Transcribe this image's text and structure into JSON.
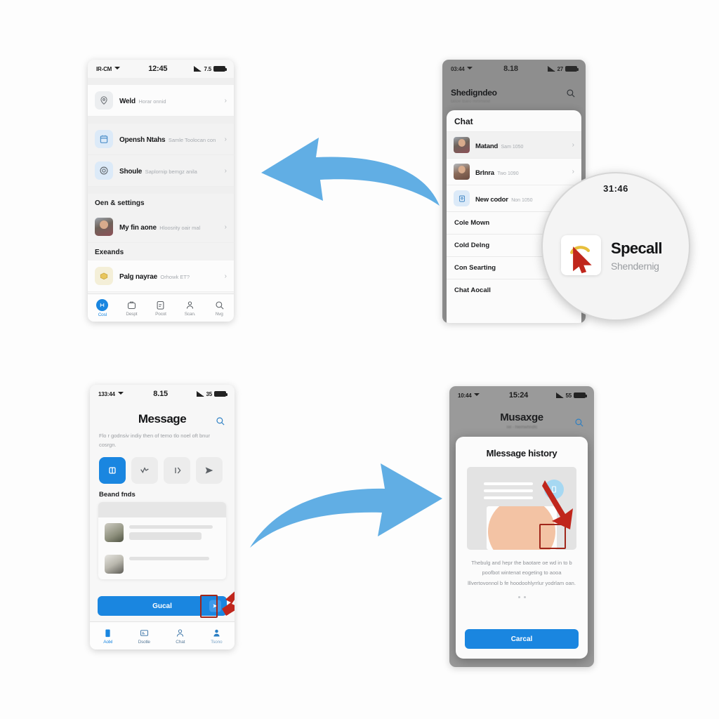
{
  "panel1": {
    "name": "settings-screen",
    "status": {
      "carrier": "IR-CM",
      "time": "12:45",
      "network": "7.5"
    },
    "rows": [
      {
        "title": "Weld",
        "subtitle": "Horar onnid",
        "icon": "location-pin-icon"
      },
      {
        "title": "Opensh Ntahs",
        "subtitle": "Samle Toolocan con",
        "icon": "calendar-icon"
      },
      {
        "title": "Shoule",
        "subtitle": "Saplornip bemgz anila",
        "icon": "target-icon"
      }
    ],
    "section_account": "Oen & settings",
    "account_row": {
      "title": "My fin aone",
      "subtitle": "Hloosrity oair mal"
    },
    "section_extra": "Exeands",
    "extra_row": {
      "title": "Palg nayrae",
      "subtitle": "Orhowk ET?"
    },
    "tabs": [
      {
        "label": "Cosl",
        "icon": "home-icon",
        "active": true
      },
      {
        "label": "Despt",
        "icon": "bag-icon",
        "active": false
      },
      {
        "label": "Pocot",
        "icon": "doc-icon",
        "active": false
      },
      {
        "label": "Scan.",
        "icon": "person-icon",
        "active": false
      },
      {
        "label": "Nvg",
        "icon": "search-icon",
        "active": false
      }
    ]
  },
  "panel2": {
    "name": "chat-sheet-screen",
    "status": {
      "carrier": "03:44",
      "time": "8.18",
      "network": "27"
    },
    "header_title": "Shedigndeo",
    "header_sub": "talloe lbaro mmmwwl",
    "search_icon": "search-icon",
    "sheet_title": "Chat",
    "contacts": [
      {
        "title": "Matand",
        "subtitle": "Sam 1050",
        "type": "avatar"
      },
      {
        "title": "Brlnra",
        "subtitle": "Two 1090",
        "type": "avatar"
      },
      {
        "title": "New codor",
        "subtitle": "Non 1050",
        "type": "icon"
      }
    ],
    "items": [
      "Cole Mown",
      "Cold Delng",
      "Con Searting",
      "Chat Aocall"
    ]
  },
  "loupe": {
    "name": "magnified-detail",
    "time": "31:46",
    "title": "Specall",
    "subtitle": "Shendernig",
    "cursor_icon": "red-cursor-icon"
  },
  "panel3": {
    "name": "message-composer-screen",
    "status": {
      "carrier": "133:44",
      "time": "8.15",
      "network": "35"
    },
    "title": "Message",
    "search_icon": "search-icon",
    "description": "Flo r godnsiv indiy then of temo tlo noel oft bnur cosrgn.",
    "chips": [
      {
        "icon": "grid-icon",
        "selected": true
      },
      {
        "icon": "wave-icon",
        "selected": false
      },
      {
        "icon": "pause-icon",
        "selected": false
      },
      {
        "icon": "send-icon",
        "selected": false
      }
    ],
    "section_label": "Beand fnds",
    "cta_label": "Gucal",
    "cta_send_icon": "send-icon",
    "tabs": [
      {
        "label": "Aolxl",
        "icon": "building-icon",
        "active": true
      },
      {
        "label": "Dsotle",
        "icon": "card-icon",
        "active": false
      },
      {
        "label": "Chat",
        "icon": "person-outline-icon",
        "active": false
      },
      {
        "label": "Tsono",
        "icon": "person-filled-icon",
        "active": true
      }
    ]
  },
  "panel4": {
    "name": "message-history-modal",
    "status": {
      "carrier": "10:44",
      "time": "15:24",
      "network": "55"
    },
    "header_title": "Musaxge",
    "header_sub": "Tel - hlemwhndtc",
    "search_icon": "search-icon",
    "modal_title": "Mlessage history",
    "badge_icon": "doc-icon",
    "description": "Thebulg and hepr the baotare oe wd in to b poofbot wintenat eogeting to aooa lllvertovonnol b fe hoodoohlyrrlur yodrlam oan.",
    "dots": 2,
    "button_label": "Carcal"
  },
  "arrows": {
    "top": {
      "name": "arrow-left",
      "direction": "left",
      "color": "#61aee4"
    },
    "bottom": {
      "name": "arrow-right",
      "direction": "right",
      "color": "#61aee4"
    }
  },
  "colors": {
    "accent_blue": "#1a86e0",
    "arrow_blue": "#61aee4",
    "highlight_red": "#a0261a",
    "background": "#fdfdfd"
  }
}
